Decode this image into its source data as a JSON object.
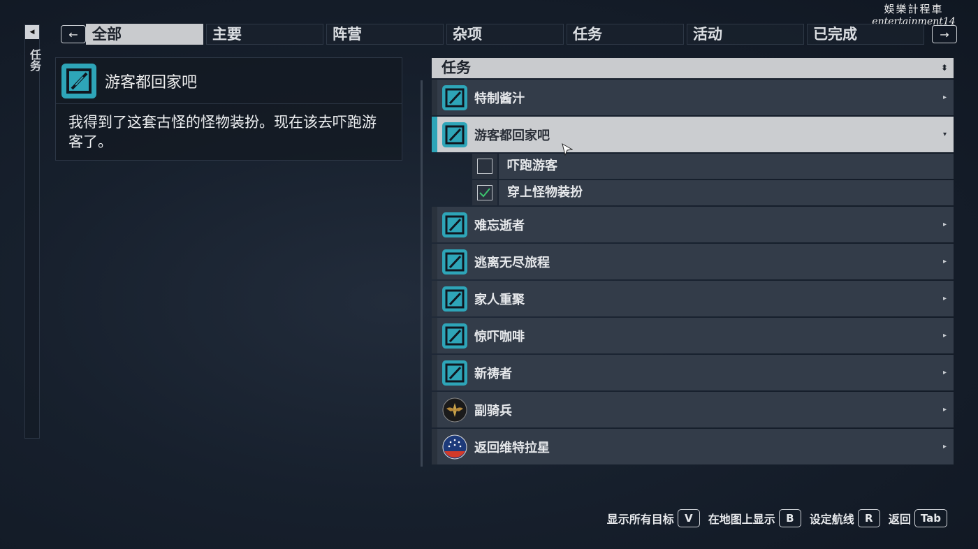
{
  "watermark": {
    "line1": "娛樂計程車",
    "line2": "entertainment14"
  },
  "side_rail": {
    "label": "任务"
  },
  "tabs": {
    "prev": "←",
    "next": "→",
    "items": [
      {
        "label": "全部",
        "active": true
      },
      {
        "label": "主要"
      },
      {
        "label": "阵营"
      },
      {
        "label": "杂项"
      },
      {
        "label": "任务"
      },
      {
        "label": "活动"
      },
      {
        "label": "已完成"
      }
    ]
  },
  "detail": {
    "title": "游客都回家吧",
    "description": "我得到了这套古怪的怪物装扮。现在该去吓跑游客了。"
  },
  "list": {
    "header": "任务",
    "sort_icon": "⬍",
    "quests": [
      {
        "label": "特制酱汁",
        "icon": "quest-icon"
      },
      {
        "label": "游客都回家吧",
        "icon": "quest-icon",
        "selected": true,
        "expanded": true,
        "objectives": [
          {
            "label": "吓跑游客",
            "done": false
          },
          {
            "label": "穿上怪物装扮",
            "done": true
          }
        ]
      },
      {
        "label": "难忘逝者",
        "icon": "quest-icon"
      },
      {
        "label": "逃离无尽旅程",
        "icon": "quest-icon"
      },
      {
        "label": "家人重聚",
        "icon": "quest-icon"
      },
      {
        "label": "惊吓咖啡",
        "icon": "quest-icon"
      },
      {
        "label": "新祷者",
        "icon": "quest-icon"
      },
      {
        "label": "副骑兵",
        "icon": "eagle-emblem-icon"
      },
      {
        "label": "返回维特拉星",
        "icon": "constellation-emblem-icon"
      }
    ]
  },
  "footer": {
    "hints": [
      {
        "label": "显示所有目标",
        "key": "V"
      },
      {
        "label": "在地图上显示",
        "key": "B"
      },
      {
        "label": "设定航线",
        "key": "R"
      },
      {
        "label": "返回",
        "key": "Tab"
      }
    ]
  },
  "colors": {
    "accent": "#2ea5b8",
    "selected_bg": "#cbcdd0",
    "row_bg": "#333c49"
  }
}
